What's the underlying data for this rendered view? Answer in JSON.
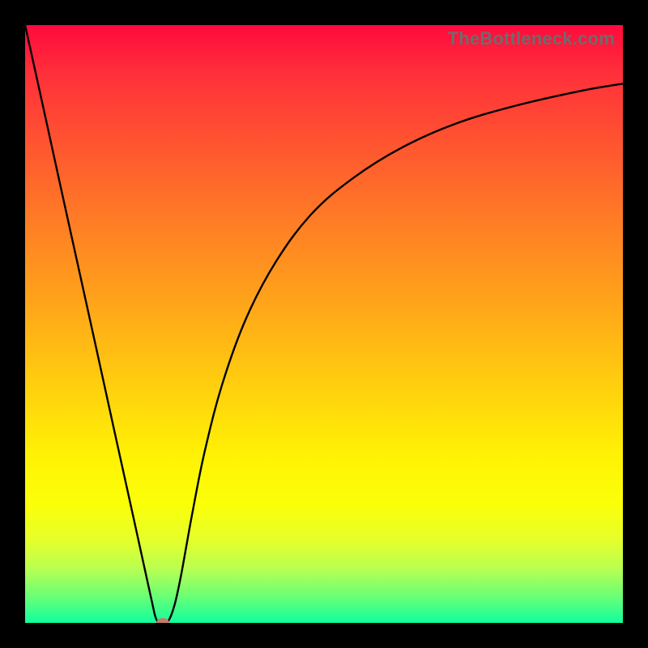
{
  "watermark": "TheBottleneck.com",
  "chart_data": {
    "type": "line",
    "title": "",
    "xlabel": "",
    "ylabel": "",
    "xlim": [
      0,
      100
    ],
    "ylim": [
      0,
      100
    ],
    "grid": false,
    "legend": false,
    "series": [
      {
        "name": "bottleneck-curve",
        "x": [
          0.0,
          3.0,
          6.0,
          9.0,
          12.0,
          15.0,
          18.0,
          21.0,
          22.0,
          23.0,
          24.0,
          25.0,
          26.0,
          27.0,
          28.0,
          30.0,
          33.0,
          37.0,
          42.0,
          48.0,
          55.0,
          63.0,
          72.0,
          82.0,
          93.0,
          100.0
        ],
        "y": [
          100.0,
          86.4,
          72.7,
          59.1,
          45.5,
          31.8,
          18.2,
          4.5,
          0.5,
          0.0,
          0.4,
          3.0,
          7.5,
          13.0,
          18.5,
          28.5,
          40.0,
          51.0,
          60.5,
          68.5,
          74.5,
          79.5,
          83.5,
          86.5,
          89.0,
          90.2
        ]
      }
    ],
    "marker": {
      "x": 23.0,
      "y": 0.0,
      "color": "#c57a6b"
    },
    "gradient_stops": [
      {
        "pos": 0.0,
        "color": "#ff0a3c"
      },
      {
        "pos": 0.2,
        "color": "#ff5530"
      },
      {
        "pos": 0.45,
        "color": "#ffa01b"
      },
      {
        "pos": 0.72,
        "color": "#fff205"
      },
      {
        "pos": 0.86,
        "color": "#e6ff2a"
      },
      {
        "pos": 1.0,
        "color": "#0fff9e"
      }
    ]
  }
}
